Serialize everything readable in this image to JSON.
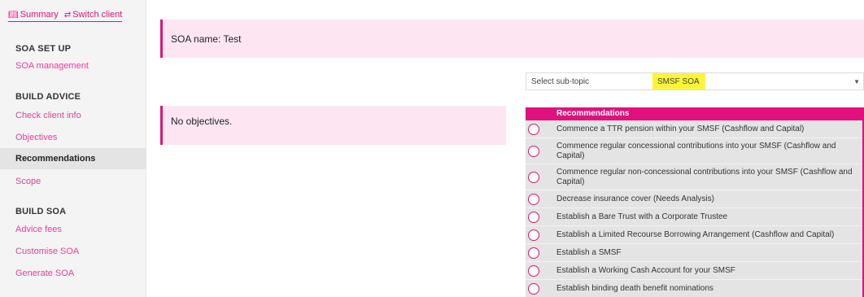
{
  "topnav": {
    "summary_label": "Summary",
    "switch_label": "Switch client",
    "summary_icon": "book-icon",
    "switch_icon": "swap-icon"
  },
  "sidebar": {
    "sections": [
      {
        "title": "SOA SET UP",
        "items": [
          "SOA management"
        ]
      },
      {
        "title": "BUILD ADVICE",
        "items": [
          "Check client info",
          "Objectives",
          "Recommendations",
          "Scope"
        ]
      },
      {
        "title": "BUILD SOA",
        "items": [
          "Advice fees",
          "Customise SOA",
          "Generate SOA"
        ]
      }
    ],
    "active_item": "Recommendations"
  },
  "soa": {
    "label": "SOA name: Test"
  },
  "objectives": {
    "empty_text": "No objectives."
  },
  "subtopic": {
    "label": "Select sub-topic",
    "value": "SMSF SOA"
  },
  "recommendations": {
    "header": "Recommendations",
    "items": [
      "Commence a TTR pension within your SMSF (Cashflow and Capital)",
      "Commence regular concessional contributions into your SMSF (Cashflow and Capital)",
      "Commence regular non-concessional contributions into your SMSF (Cashflow and Capital)",
      "Decrease insurance cover (Needs Analysis)",
      "Establish a Bare Trust with a Corporate Trustee",
      "Establish a Limited Recourse Borrowing Arrangement (Cashflow and Capital)",
      "Establish a SMSF",
      "Establish a Working Cash Account for your SMSF",
      "Establish binding death benefit nominations"
    ]
  },
  "colors": {
    "accent": "#e0117d",
    "link": "#e83f98",
    "highlight": "#fbf53a",
    "panel_bg": "#fde6f2"
  }
}
